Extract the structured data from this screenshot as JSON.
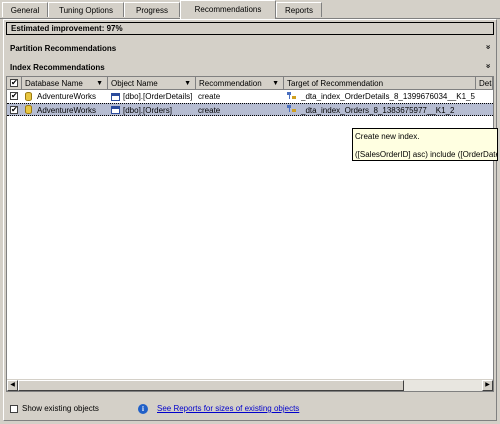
{
  "tabs": [
    {
      "label": "General"
    },
    {
      "label": "Tuning Options"
    },
    {
      "label": "Progress"
    },
    {
      "label": "Recommendations",
      "active": true
    },
    {
      "label": "Reports"
    }
  ],
  "estimated_improvement": "Estimated improvement:  97%",
  "sections": {
    "partition": "Partition Recommendations",
    "index": "Index Recommendations",
    "collapse_glyph": "»"
  },
  "grid": {
    "columns": [
      "Database Name",
      "Object Name",
      "Recommendation",
      "Target of Recommendation",
      "Detai"
    ],
    "header_check": "✔",
    "rows": [
      {
        "checked": "✔",
        "database": "AdventureWorks",
        "object": "[dbo].[OrderDetails]",
        "recommendation": "create",
        "target": "_dta_index_OrderDetails_8_1399676034__K1_5"
      },
      {
        "checked": "✔",
        "database": "AdventureWorks",
        "object": "[dbo].[Orders]",
        "recommendation": "create",
        "target": "_dta_index_Orders_8_1383675977__K1_2"
      }
    ]
  },
  "tooltip": {
    "line1": "Create new index.",
    "line2": "([SalesOrderID] asc) include ([OrderDate])"
  },
  "footer": {
    "show_existing_label": "Show existing objects",
    "reports_link": "See Reports for sizes of existing objects",
    "info_glyph": "i"
  },
  "colors": {
    "selected_row": "#b6bdd2",
    "tooltip_bg": "#ffffe1",
    "link": "#0000cc"
  }
}
